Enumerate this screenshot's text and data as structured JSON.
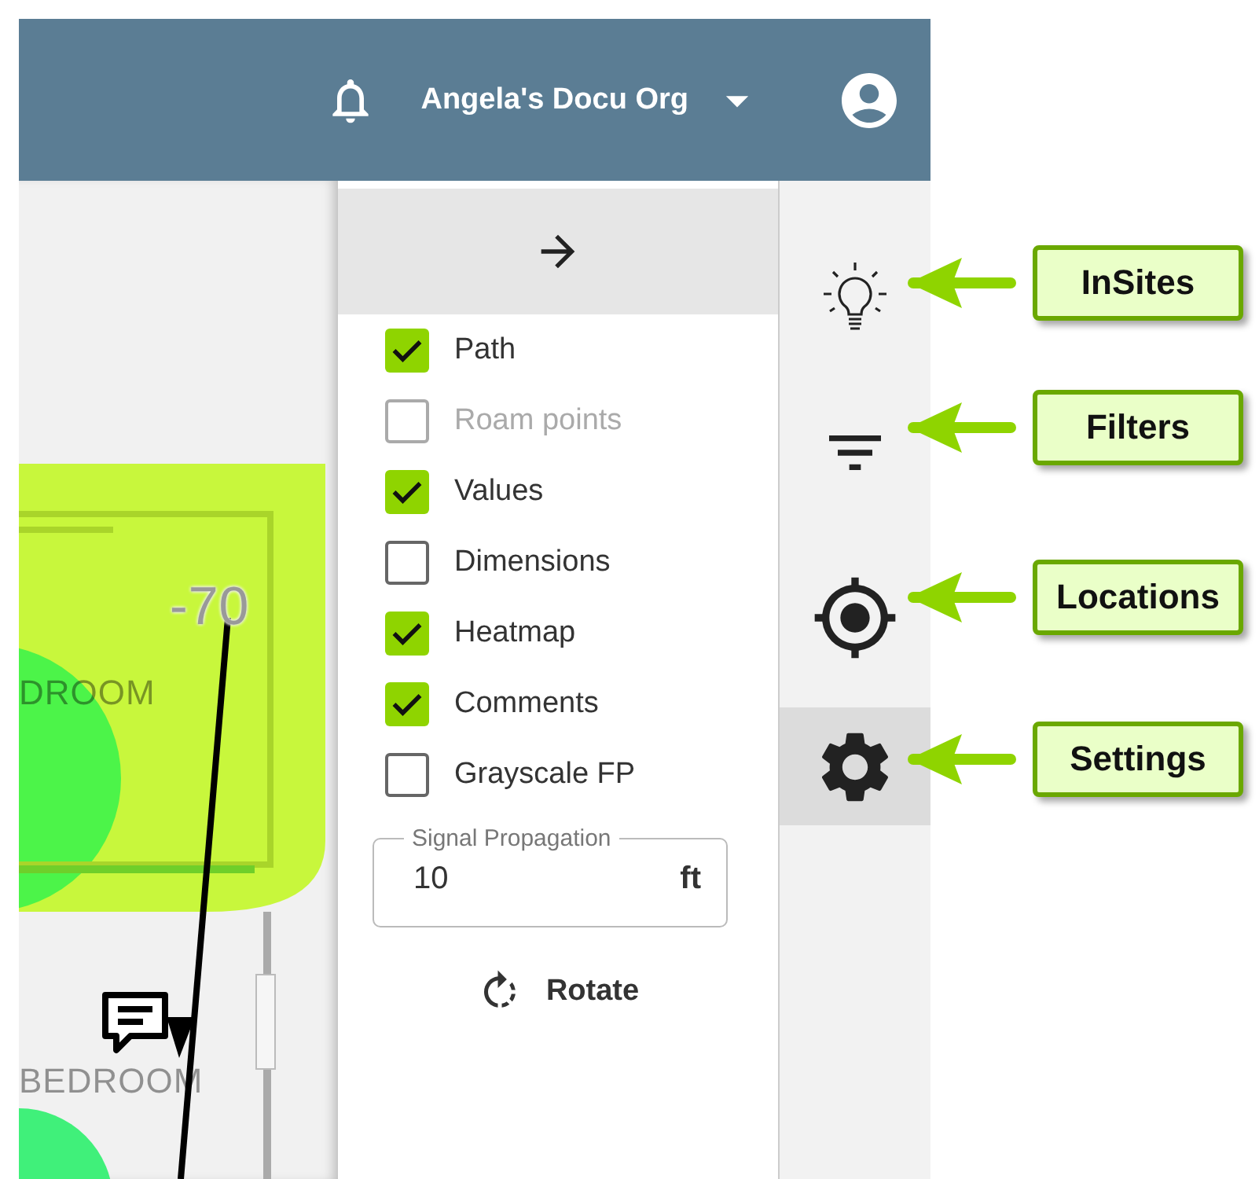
{
  "top_bar": {
    "org_name": "Angela's Docu Org"
  },
  "map": {
    "labels": [
      {
        "kind": "value",
        "text": "-70"
      },
      {
        "kind": "room",
        "text": "DROOM"
      },
      {
        "kind": "room",
        "text": "BEDROOM"
      }
    ]
  },
  "settings_panel": {
    "options": [
      {
        "label": "Path",
        "checked": true,
        "disabled": false
      },
      {
        "label": "Roam points",
        "checked": false,
        "disabled": true
      },
      {
        "label": "Values",
        "checked": true,
        "disabled": false
      },
      {
        "label": "Dimensions",
        "checked": false,
        "disabled": false
      },
      {
        "label": "Heatmap",
        "checked": true,
        "disabled": false
      },
      {
        "label": "Comments",
        "checked": true,
        "disabled": false
      },
      {
        "label": "Grayscale FP",
        "checked": false,
        "disabled": false
      }
    ],
    "signal_propagation": {
      "label": "Signal Propagation",
      "value": "10",
      "unit": "ft"
    },
    "rotate_button": "Rotate"
  },
  "rail": {
    "items": [
      {
        "kind": "bulb",
        "selected": false
      },
      {
        "kind": "filter",
        "selected": false
      },
      {
        "kind": "target",
        "selected": false
      },
      {
        "kind": "gear",
        "selected": true
      }
    ]
  },
  "callouts": [
    "InSites",
    "Filters",
    "Locations",
    "Settings"
  ]
}
